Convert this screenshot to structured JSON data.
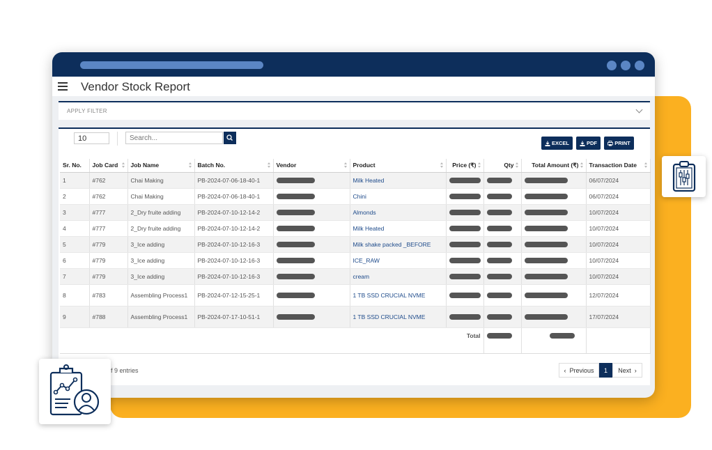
{
  "page": {
    "title": "Vendor Stock Report"
  },
  "filter": {
    "label": "APPLY FILTER"
  },
  "controls": {
    "page_size": "10",
    "search_placeholder": "Search...",
    "excel_label": "EXCEL",
    "pdf_label": "PDF",
    "print_label": "PRINT"
  },
  "table": {
    "headers": [
      "Sr. No.",
      "Job Card",
      "Job Name",
      "Batch No.",
      "Vendor",
      "Product",
      "Price (₹)",
      "Qty",
      "Total Amount (₹)",
      "Transaction Date"
    ],
    "rows": [
      {
        "sr": "1",
        "job_card": "#762",
        "job_name": "Chai Making",
        "batch": "PB-2024-07-06-18-40-1",
        "product": "Milk Heated",
        "date": "06/07/2024"
      },
      {
        "sr": "2",
        "job_card": "#762",
        "job_name": "Chai Making",
        "batch": "PB-2024-07-06-18-40-1",
        "product": "Chini",
        "date": "06/07/2024"
      },
      {
        "sr": "3",
        "job_card": "#777",
        "job_name": "2_Dry fruite adding",
        "batch": "PB-2024-07-10-12-14-2",
        "product": "Almonds",
        "date": "10/07/2024"
      },
      {
        "sr": "4",
        "job_card": "#777",
        "job_name": "2_Dry fruite adding",
        "batch": "PB-2024-07-10-12-14-2",
        "product": "Milk Heated",
        "date": "10/07/2024"
      },
      {
        "sr": "5",
        "job_card": "#779",
        "job_name": "3_Ice adding",
        "batch": "PB-2024-07-10-12-16-3",
        "product": "Milk shake packed _BEFORE",
        "date": "10/07/2024"
      },
      {
        "sr": "6",
        "job_card": "#779",
        "job_name": "3_Ice adding",
        "batch": "PB-2024-07-10-12-16-3",
        "product": "ICE_RAW",
        "date": "10/07/2024"
      },
      {
        "sr": "7",
        "job_card": "#779",
        "job_name": "3_Ice adding",
        "batch": "PB-2024-07-10-12-16-3",
        "product": "cream",
        "date": "10/07/2024"
      },
      {
        "sr": "8",
        "job_card": "#783",
        "job_name": "Assembling Process1",
        "batch": "PB-2024-07-12-15-25-1",
        "product": "1 TB SSD CRUCIAL NVME",
        "date": "12/07/2024"
      },
      {
        "sr": "9",
        "job_card": "#788",
        "job_name": "Assembling Process1",
        "batch": "PB-2024-07-17-10-51-1",
        "product": "1 TB SSD CRUCIAL NVME",
        "date": "17/07/2024"
      }
    ],
    "total_label": "Total"
  },
  "footer": {
    "entries_text": "of 9 entries",
    "prev_label": "Previous",
    "current_page": "1",
    "next_label": "Next"
  },
  "colors": {
    "navy": "#0d2e5b",
    "accent_orange": "#fbb020",
    "link_blue": "#1d4a8a"
  }
}
